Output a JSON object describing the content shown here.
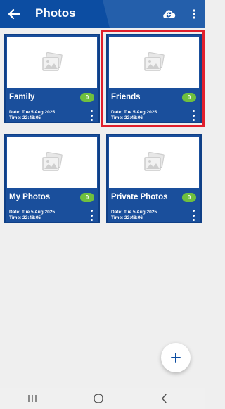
{
  "appbar": {
    "title": "Photos",
    "background": "#0c4da2"
  },
  "icons": {
    "back": "arrow-left-icon",
    "sync": "cloud-sync-icon",
    "menu": "more-vert-icon",
    "thumbnail": "image-placeholder-icon",
    "fab": "plus-icon"
  },
  "albums": [
    {
      "name": "Family",
      "count": "0",
      "date": "Date: Tue 5 Aug 2025",
      "time": "Time:  22:48:05"
    },
    {
      "name": "Friends",
      "count": "0",
      "date": "Date: Tue 5 Aug 2025",
      "time": "Time:  22:48:06"
    },
    {
      "name": "My Photos",
      "count": "0",
      "date": "Date: Tue 5 Aug 2025",
      "time": "Time:  22:48:05"
    },
    {
      "name": "Private Photos",
      "count": "0",
      "date": "Date: Tue 5 Aug 2025",
      "time": "Time:  22:48:06"
    }
  ],
  "colors": {
    "card": "#1a4f9c",
    "badge": "#6fbf3e",
    "highlight": "#e11f2c"
  }
}
